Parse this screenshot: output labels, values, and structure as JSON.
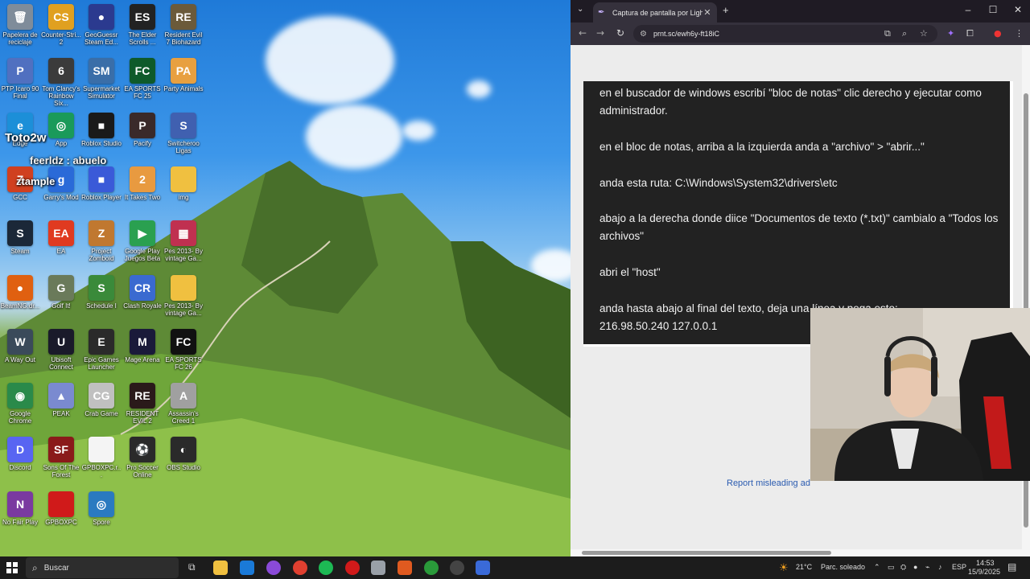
{
  "desktop": {
    "icons": [
      {
        "label": "Papelera de reciclaje",
        "glyph": "🗑",
        "color": "#7f8c9a",
        "icon": "recycle-bin-icon"
      },
      {
        "label": "Counter-Stri... 2",
        "glyph": "CS",
        "color": "#e0a020",
        "icon": "counter-strike-icon"
      },
      {
        "label": "GeoGuessr Steam Ed...",
        "glyph": "●",
        "color": "#2b3a8f",
        "icon": "geoguessr-icon"
      },
      {
        "label": "The Elder Scrolls ...",
        "glyph": "ES",
        "color": "#222222",
        "icon": "elder-scrolls-icon"
      },
      {
        "label": "Resident Evil 7 Biohazard",
        "glyph": "RE",
        "color": "#6b5a3a",
        "icon": "resident-evil-7-icon"
      },
      {
        "label": "PTP Icaro 90 Final",
        "glyph": "P",
        "color": "#5070c0",
        "icon": "ptp-icaro-icon"
      },
      {
        "label": "Tom Clancy's Rainbow Six...",
        "glyph": "6",
        "color": "#3b3b3b",
        "icon": "rainbow-six-icon"
      },
      {
        "label": "Supermarket Simulator",
        "glyph": "SM",
        "color": "#3a6ea8",
        "icon": "supermarket-simulator-icon"
      },
      {
        "label": "EA SPORTS FC 25",
        "glyph": "FC",
        "color": "#0e5a2a",
        "icon": "ea-fc25-icon"
      },
      {
        "label": "Party Animals",
        "glyph": "PA",
        "color": "#e8a040",
        "icon": "party-animals-icon"
      },
      {
        "label": "Edge",
        "glyph": "e",
        "color": "#1c8fd8",
        "icon": "edge-icon"
      },
      {
        "label": "App",
        "glyph": "◎",
        "color": "#1a9a5a",
        "icon": "app-icon"
      },
      {
        "label": "Roblox Studio",
        "glyph": "■",
        "color": "#1a1a1a",
        "icon": "roblox-studio-icon"
      },
      {
        "label": "Pacify",
        "glyph": "P",
        "color": "#3a2a2a",
        "icon": "pacify-icon"
      },
      {
        "label": "Switcheroo Ligas",
        "glyph": "S",
        "color": "#4060b0",
        "icon": "switch-ligas-icon"
      },
      {
        "label": "GCC",
        "glyph": "Z",
        "color": "#d04020",
        "icon": "gcc-icon"
      },
      {
        "label": "Garry's Mod",
        "glyph": "g",
        "color": "#2a6ad8",
        "icon": "garrys-mod-icon"
      },
      {
        "label": "Roblox Player",
        "glyph": "■",
        "color": "#3a5ad8",
        "icon": "roblox-player-icon"
      },
      {
        "label": "It Takes Two",
        "glyph": "2",
        "color": "#e89a40",
        "icon": "it-takes-two-icon"
      },
      {
        "label": "img",
        "glyph": "",
        "color": "#f0c040",
        "icon": "folder-icon"
      },
      {
        "label": "Steam",
        "glyph": "S",
        "color": "#1b2838",
        "icon": "steam-icon"
      },
      {
        "label": "EA",
        "glyph": "EA",
        "color": "#e03a20",
        "icon": "ea-icon"
      },
      {
        "label": "Project Zomboid",
        "glyph": "Z",
        "color": "#c07830",
        "icon": "project-zomboid-icon"
      },
      {
        "label": "Google Play Juegos Beta",
        "glyph": "▶",
        "color": "#2aa050",
        "icon": "google-play-games-icon"
      },
      {
        "label": "Pes 2013- By vintage Ga...",
        "glyph": "▦",
        "color": "#c03050",
        "icon": "rar-archive-icon"
      },
      {
        "label": "BeamNG.dr...",
        "glyph": "●",
        "color": "#e06010",
        "icon": "beamng-icon"
      },
      {
        "label": "Golf It!",
        "glyph": "G",
        "color": "#6a7a5a",
        "icon": "golf-it-icon"
      },
      {
        "label": "Schedule I",
        "glyph": "S",
        "color": "#3a8a3a",
        "icon": "schedule-one-icon"
      },
      {
        "label": "Clash Royale",
        "glyph": "CR",
        "color": "#3a6ad0",
        "icon": "clash-royale-icon"
      },
      {
        "label": "Pes 2013- By vintage Ga...",
        "glyph": "",
        "color": "#f0c040",
        "icon": "folder-icon"
      },
      {
        "label": "A Way Out",
        "glyph": "W",
        "color": "#3a4a5a",
        "icon": "a-way-out-icon"
      },
      {
        "label": "Ubisoft Connect",
        "glyph": "U",
        "color": "#1a1a2a",
        "icon": "ubisoft-connect-icon"
      },
      {
        "label": "Epic Games Launcher",
        "glyph": "E",
        "color": "#2a2a2a",
        "icon": "epic-games-icon"
      },
      {
        "label": "Mage Arena",
        "glyph": "M",
        "color": "#1a1a3a",
        "icon": "mage-arena-icon"
      },
      {
        "label": "EA SPORTS FC 26",
        "glyph": "FC",
        "color": "#111111",
        "icon": "ea-fc26-icon"
      },
      {
        "label": "Google Chrome",
        "glyph": "◉",
        "color": "#2a8a4a",
        "icon": "chrome-icon"
      },
      {
        "label": "PEAK",
        "glyph": "▲",
        "color": "#7a8ad0",
        "icon": "peak-icon"
      },
      {
        "label": "Crab Game",
        "glyph": "CG",
        "color": "#c0c0c0",
        "icon": "crab-game-icon"
      },
      {
        "label": "RESIDENT EVIL 2",
        "glyph": "RE",
        "color": "#2a1a1a",
        "icon": "resident-evil-2-icon"
      },
      {
        "label": "Assassin's Creed 1",
        "glyph": "A",
        "color": "#a0a0a0",
        "icon": "assassins-creed-icon"
      },
      {
        "label": "Discord",
        "glyph": "D",
        "color": "#5865f2",
        "icon": "discord-icon"
      },
      {
        "label": "Sons Of The Forest",
        "glyph": "SF",
        "color": "#8a1a1a",
        "icon": "sons-of-the-forest-icon"
      },
      {
        "label": "GPBOXPC.r...",
        "glyph": "",
        "color": "#f4f4f4",
        "icon": "file-icon"
      },
      {
        "label": "Pro Soccer Online",
        "glyph": "⚽",
        "color": "#2a2a2a",
        "icon": "pro-soccer-online-icon"
      },
      {
        "label": "OBS Studio",
        "glyph": "◐",
        "color": "#2a2a2a",
        "icon": "obs-icon"
      },
      {
        "label": "No Fair Play",
        "glyph": "N",
        "color": "#7a3aa0",
        "icon": "no-fair-play-icon"
      },
      {
        "label": "GPBOXPC",
        "glyph": "",
        "color": "#d01a1a",
        "icon": "gpboxpc-icon"
      },
      {
        "label": "Spore",
        "glyph": "◎",
        "color": "#2a7ac0",
        "icon": "spore-icon"
      }
    ],
    "overlay_texts": [
      "Toto2w",
      "feerldz : abuelo",
      "ztample"
    ]
  },
  "browser": {
    "tab_title": "Captura de pantalla por Lightsh",
    "url": "prnt.sc/ewh6y-ft18iC",
    "screenshot_lines": [
      "en el buscador de windows escribí \"bloc de notas\" clic derecho y ejecutar como",
      "administrador.",
      "en el bloc de notas, arriba a la izquierda anda a \"archivo\" > \"abrir...\"",
      "anda esta ruta: C:\\Windows\\System32\\drivers\\etc",
      "abajo a la derecha donde diice \"Documentos de texto (*.txt)\" cambialo a \"Todos los",
      "archivos\"",
      "abri el \"host\"",
      "anda hasta abajo al final del texto, deja una línea y pega esto:",
      "216.98.50.240 127.0.0.1"
    ],
    "report_link": "Report misleading ad"
  },
  "taskbar": {
    "search_placeholder": "Buscar",
    "weather_temp": "21°C",
    "weather_text": "Parc. soleado",
    "language": "ESP",
    "time": "14:53",
    "date": "15/9/2025"
  }
}
